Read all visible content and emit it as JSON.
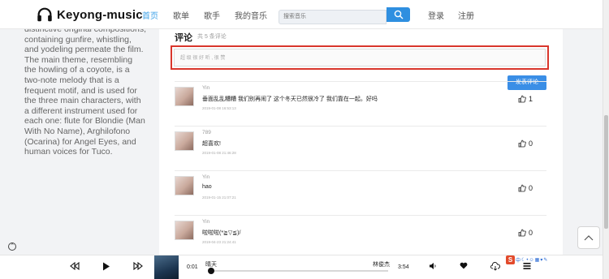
{
  "header": {
    "logo_text": "Keyong-music",
    "nav": [
      "首页",
      "歌单",
      "歌手",
      "我的音乐"
    ],
    "search_placeholder": "搜索音乐",
    "login": "登录",
    "register": "注册"
  },
  "sidebar": {
    "text": "distinctive original compositions, containing gunfire, whistling, and yodeling permeate the film. The main theme, resembling the howling of a coyote, is a two-note melody that is a frequent motif, and is used for the three main characters, with a different instrument used for each one: flute for Blondie (Man With No Name), Arghilofono (Ocarina) for Angel Eyes, and human voices for Tuco."
  },
  "comments_section": {
    "title": "评论",
    "count_text": "共 5 条评论",
    "input_placeholder": "超 级 很 好 听 , 很 赞",
    "submit_label": "发表评论",
    "items": [
      {
        "name": "Yin",
        "text": "垂面乱乱糟糟 我们别再闹了 这个冬天已然很冷了 我们靠在一起。好吗",
        "date": "2019-01-08 16:53:13",
        "likes": "1"
      },
      {
        "name": "789",
        "text": "超喜欢!",
        "date": "2019-01-08 21:46:28",
        "likes": "0"
      },
      {
        "name": "Yin",
        "text": "hao",
        "date": "2019-01-15 21:07:21",
        "likes": "0"
      },
      {
        "name": "Yin",
        "text": "啦啦啦(*≧▽≦)/",
        "date": "2019-04-23 21:24:41",
        "likes": "0"
      }
    ]
  },
  "player": {
    "current_time": "0:01",
    "title": "晴天",
    "artist": "林俊杰",
    "total_time": "3:54",
    "progress": 0.004
  },
  "extension": {
    "badge": "S",
    "label": "中"
  },
  "colors": {
    "accent": "#3a8ee6",
    "nav_active": "#3ea2e8",
    "input_border": "#d9362c"
  }
}
